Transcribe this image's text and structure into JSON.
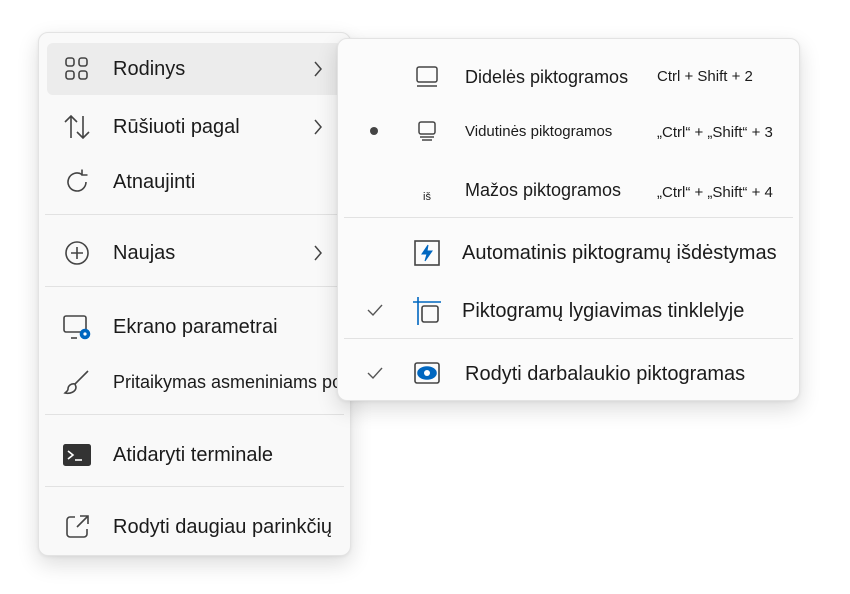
{
  "main_menu": {
    "items": [
      {
        "label": "Rodinys",
        "icon": "grid-icon"
      },
      {
        "label": "Rūšiuoti pagal",
        "icon": "sort-arrows-icon"
      },
      {
        "label": "Atnaujinti",
        "icon": "refresh-icon"
      },
      {
        "label": "Naujas",
        "icon": "add-circle-icon"
      },
      {
        "label": "Ekrano parametrai",
        "icon": "display-settings-icon"
      },
      {
        "label": "Pritaikymas asmeniniams poreikiams",
        "icon": "brush-icon"
      },
      {
        "label": "Atidaryti terminale",
        "icon": "terminal-icon"
      },
      {
        "label": "Rodyti daugiau parinkčių",
        "icon": "share-external-icon"
      }
    ]
  },
  "sub_menu": {
    "items": [
      {
        "label": "Didelės piktogramos",
        "shortcut": "Ctrl + Shift + 2",
        "icon": "large-icons-icon"
      },
      {
        "label": "Vidutinės piktogramos",
        "shortcut": "„Ctrl“ + „Shift“ + 3",
        "icon": "medium-icons-icon",
        "selected": true
      },
      {
        "label": "Mažos piktogramos",
        "shortcut": "„Ctrl“ + „Shift“ + 4",
        "icon": "small-icons-icon",
        "icon_text": "iš"
      },
      {
        "label": "Automatinis piktogramų išdėstymas",
        "icon": "auto-arrange-icon"
      },
      {
        "label": "Piktogramų lygiavimas tinklelyje",
        "icon": "align-grid-icon",
        "checked": true
      },
      {
        "label": "Rodyti darbalaukio piktogramas",
        "icon": "show-desktop-icons-icon",
        "checked": true
      }
    ]
  },
  "colors": {
    "accent": "#0067c0",
    "icon": "#444444"
  }
}
